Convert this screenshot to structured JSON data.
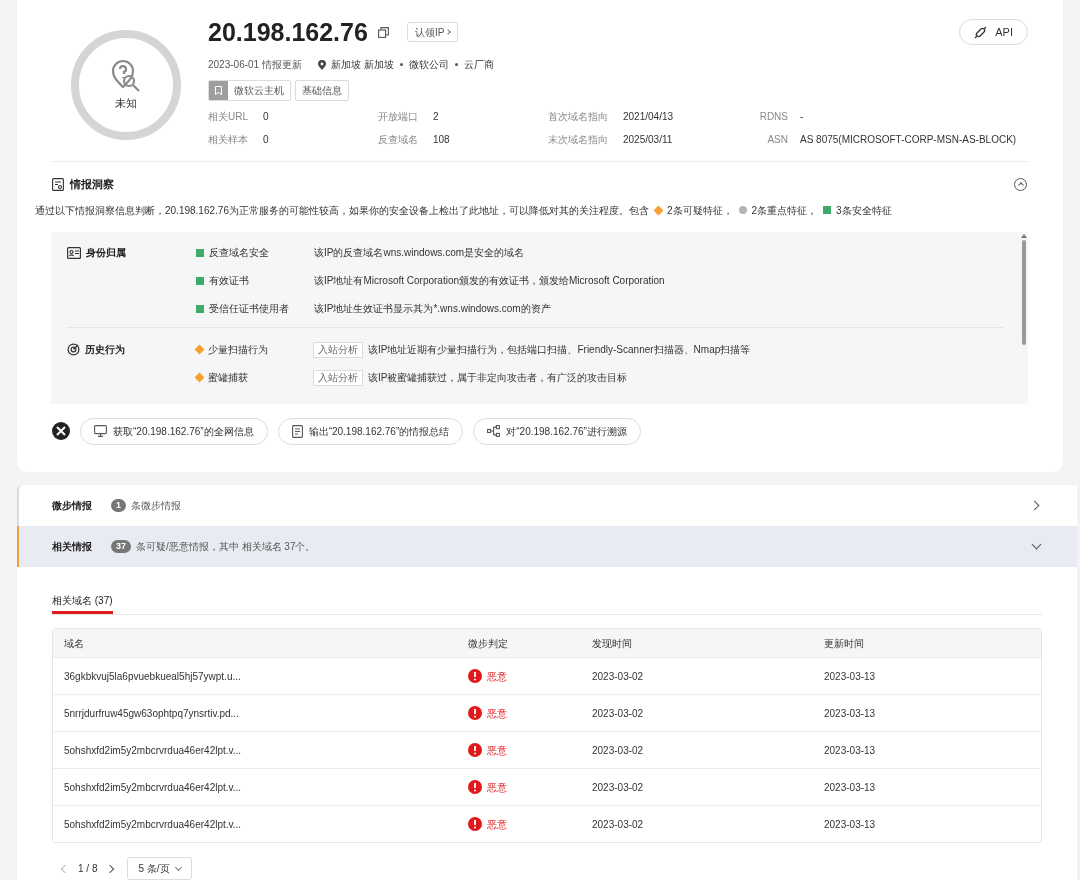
{
  "header": {
    "ip": "20.198.162.76",
    "claim_button": "认领IP",
    "verdict": "未知",
    "update_date": "2023-06-01 情报更新",
    "location": "新加坡 新加坡",
    "location_tags": [
      "微软公司",
      "云厂商"
    ],
    "tags": [
      {
        "label": "微软云主机",
        "kind": "host"
      },
      {
        "label": "基础信息",
        "kind": "plain"
      }
    ],
    "api_button": "API",
    "stats": [
      [
        {
          "label": "相关URL",
          "value": "0"
        },
        {
          "label": "开放端口",
          "value": "2"
        },
        {
          "label": "首次域名指向",
          "value": "2021/04/13"
        },
        {
          "label": "RDNS",
          "value": "-"
        }
      ],
      [
        {
          "label": "相关样本",
          "value": "0"
        },
        {
          "label": "反查域名",
          "value": "108"
        },
        {
          "label": "末次域名指向",
          "value": "2025/03/11"
        },
        {
          "label": "ASN",
          "value": "AS 8075(MICROSOFT-CORP-MSN-AS-BLOCK)"
        }
      ]
    ]
  },
  "insight": {
    "title": "情报洞察",
    "expanded": true,
    "summary": "通过以下情报洞察信息判断，20.198.162.76为正常服务的可能性较高，如果你的安全设备上检出了此地址，可以降低对其的关注程度。包含",
    "counts": [
      {
        "text": "2条可疑特征，",
        "kind": "diamond",
        "color": "#f5a030"
      },
      {
        "text": "2条重点特征，",
        "kind": "circle",
        "color": "#b4b4b4"
      },
      {
        "text": "3条安全特征",
        "kind": "square",
        "color": "#3daa6a"
      }
    ],
    "groups": [
      {
        "title": "身份归属",
        "kind": "identity",
        "items": [
          {
            "name": "反查域名安全",
            "kind": "square",
            "color": "#3daa6a",
            "detail": "该IP的反查域名wns.windows.com是安全的域名"
          },
          {
            "name": "有效证书",
            "kind": "square",
            "color": "#3daa6a",
            "detail": "该IP地址有Microsoft Corporation颁发的有效证书，颁发给Microsoft Corporation"
          },
          {
            "name": "受信任证书使用者",
            "kind": "square",
            "color": "#3daa6a",
            "detail": "该IP地址生效证书显示其为*.wns.windows.com的资产"
          }
        ]
      },
      {
        "title": "历史行为",
        "kind": "history",
        "items": [
          {
            "name": "少量扫描行为",
            "kind": "diamond",
            "color": "#f5a030",
            "tag": "入站分析",
            "detail": "该IP地址近期有少量扫描行为，包括端口扫描、Friendly-Scanner扫描器、Nmap扫描等"
          },
          {
            "name": "蜜罐捕获",
            "kind": "diamond",
            "color": "#f5a030",
            "tag": "入站分析",
            "detail": "该IP被蜜罐捕获过，属于非定向攻击者，有广泛的攻击目标"
          }
        ]
      }
    ],
    "actions": [
      {
        "label": "获取“20.198.162.76”的全网信息",
        "kind": "monitor"
      },
      {
        "label": "输出“20.198.162.76”的情报总结",
        "kind": "document"
      },
      {
        "label": "对“20.198.162.76”进行溯源",
        "kind": "trace"
      }
    ]
  },
  "sections": [
    {
      "title": "微步情报",
      "count": "1",
      "text": "条微步情报",
      "expanded": false
    },
    {
      "title": "相关情报",
      "count": "37",
      "text": "条可疑/恶意情报，其中 相关域名 37个。",
      "expanded": true
    }
  ],
  "tabs": [
    {
      "label": "相关域名 (37)",
      "selected": true
    }
  ],
  "table": {
    "columns": [
      "域名",
      "微步判定",
      "发现时间",
      "更新时间"
    ],
    "rows": [
      {
        "domain": "36gkbkvuj5la6pvuebkueal5hj57ywpt.u...",
        "verdict": "恶意",
        "kind": "malicious",
        "found": "2023-03-02",
        "updated": "2023-03-13"
      },
      {
        "domain": "5nrrjdurfruw45gw63ophtpq7ynsrtiv.pd...",
        "verdict": "恶意",
        "kind": "malicious",
        "found": "2023-03-02",
        "updated": "2023-03-13"
      },
      {
        "domain": "5ohshxfd2im5y2mbcrvrdua46er42lpt.v...",
        "verdict": "恶意",
        "kind": "malicious",
        "found": "2023-03-02",
        "updated": "2023-03-13"
      },
      {
        "domain": "5ohshxfd2im5y2mbcrvrdua46er42lpt.v...",
        "verdict": "恶意",
        "kind": "malicious",
        "found": "2023-03-02",
        "updated": "2023-03-13"
      },
      {
        "domain": "5ohshxfd2im5y2mbcrvrdua46er42lpt.v...",
        "verdict": "恶意",
        "kind": "malicious",
        "found": "2023-03-02",
        "updated": "2023-03-13"
      }
    ]
  },
  "pagination": {
    "page": "1 / 8",
    "page_size": "5 条/页"
  }
}
